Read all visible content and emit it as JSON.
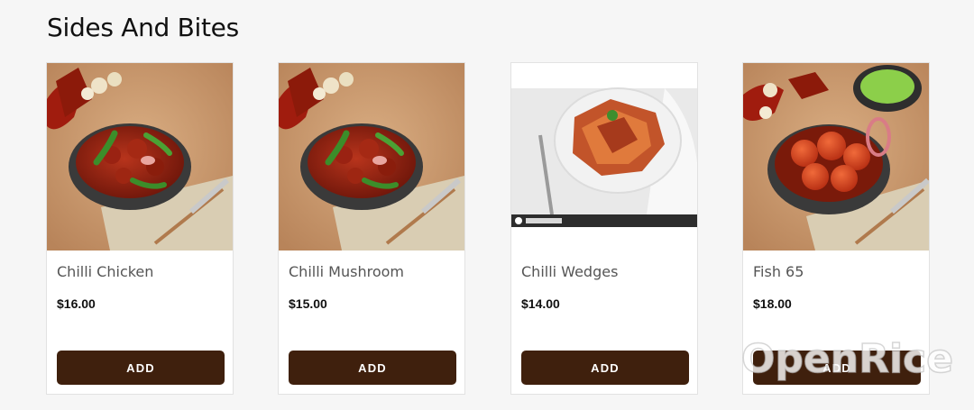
{
  "section": {
    "title": "Sides And Bites"
  },
  "products": [
    {
      "name": "Chilli Chicken",
      "price": "$16.00",
      "add_label": "ADD",
      "image": "chilli-chicken-image"
    },
    {
      "name": "Chilli Mushroom",
      "price": "$15.00",
      "add_label": "ADD",
      "image": "chilli-mushroom-image"
    },
    {
      "name": "Chilli Wedges",
      "price": "$14.00",
      "add_label": "ADD",
      "image": "chilli-wedges-image"
    },
    {
      "name": "Fish 65",
      "price": "$18.00",
      "add_label": "ADD",
      "image": "fish-65-image"
    }
  ],
  "watermark": {
    "text": "OpenRice"
  },
  "colors": {
    "button": "#3f200d",
    "background": "#f6f6f6",
    "card": "#ffffff"
  }
}
